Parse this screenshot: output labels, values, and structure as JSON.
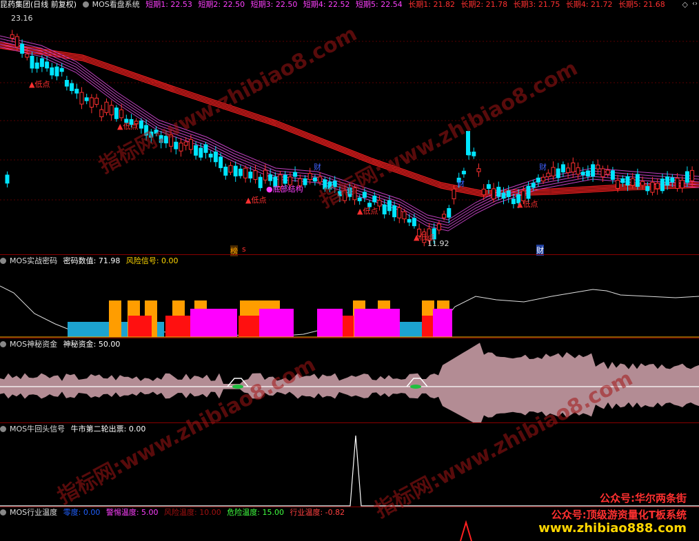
{
  "main": {
    "stock_name": "昆药集团",
    "period": "(日线 前复权)",
    "indicator": "MOS看盘系统",
    "short_labels": [
      "短期1: 22.53",
      "短期2: 22.50",
      "短期3: 22.50",
      "短期4: 22.52",
      "短期5: 22.54"
    ],
    "long_labels": [
      "长期1: 21.82",
      "长期2: 21.78",
      "长期3: 21.75",
      "长期4: 21.72",
      "长期5: 21.68"
    ],
    "high_price": "23.16",
    "low_price": "11.92",
    "annotations": {
      "low_point": "低点",
      "bottom_structure": "底部结构",
      "cai_label": "财",
      "bang_label": "榜",
      "s_label": "s"
    },
    "colors": {
      "up": "#ff3030",
      "down": "#00e5ff",
      "short_ma": "#c040c0",
      "long_ma": "#ff2020"
    }
  },
  "panel2": {
    "name": "MOS实战密码",
    "field1": "密码数值: 71.98",
    "field2": "风险信号: 0.00"
  },
  "panel3": {
    "name": "MOS神秘资金",
    "field1": "神秘资金: 50.00"
  },
  "panel4": {
    "name": "MOS牛回头信号",
    "field1": "牛市第二轮出票: 0.00"
  },
  "panel5": {
    "name": "MOS行业温度",
    "fields": [
      {
        "text": "零度: 0.00",
        "color": "#2060ff"
      },
      {
        "text": "警惕温度: 5.00",
        "color": "#ff40ff"
      },
      {
        "text": "风险温度: 10.00",
        "color": "#a01010"
      },
      {
        "text": "危险温度: 15.00",
        "color": "#40ff40"
      },
      {
        "text": "行业温度: -0.82",
        "color": "#ff4040"
      }
    ]
  },
  "watermark": {
    "site": "www.zhibiao8.com",
    "cn": "指标网:"
  },
  "promo": {
    "line1": "公众号:华尔两条街",
    "line2": "公众号:顶级游资量化T板系统",
    "line3": "www.zhibiao888.com"
  },
  "window_controls": {
    "expand": "◇",
    "collapse": "‹›"
  }
}
